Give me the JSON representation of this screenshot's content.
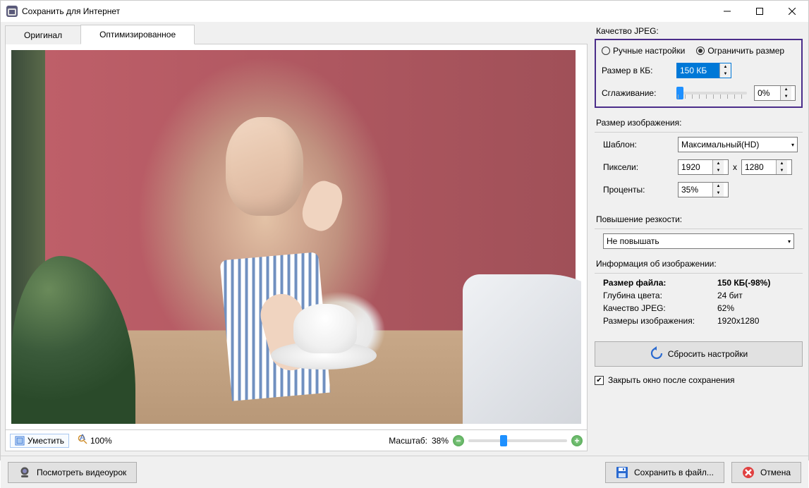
{
  "window": {
    "title": "Сохранить для Интернет"
  },
  "tabs": {
    "original": "Оригинал",
    "optimized": "Оптимизированное"
  },
  "preview_bar": {
    "fit_label": "Уместить",
    "zoom_auto_label": "100%",
    "scale_label": "Масштаб:",
    "scale_value": "38%"
  },
  "quality": {
    "group_label": "Качество JPEG:",
    "manual_label": "Ручные настройки",
    "limit_label": "Ограничить размер",
    "size_kb_label": "Размер в КБ:",
    "size_kb_value": "150 КБ",
    "smoothing_label": "Сглаживание:",
    "smoothing_value": "0%"
  },
  "image_size": {
    "group_label": "Размер изображения:",
    "template_label": "Шаблон:",
    "template_value": "Максимальный(HD)",
    "pixels_label": "Пиксели:",
    "pixels_w": "1920",
    "pixels_x": "x",
    "pixels_h": "1280",
    "percent_label": "Проценты:",
    "percent_value": "35%"
  },
  "sharpen": {
    "group_label": "Повышение резкости:",
    "value": "Не повышать"
  },
  "info": {
    "group_label": "Информация об изображении:",
    "filesize_label": "Размер файла:",
    "filesize_value": "150 КБ(-98%)",
    "depth_label": "Глубина цвета:",
    "depth_value": "24 бит",
    "jpeg_label": "Качество JPEG:",
    "jpeg_value": "62%",
    "dims_label": "Размеры изображения:",
    "dims_value": "1920x1280"
  },
  "reset_label": "Сбросить настройки",
  "close_after_save_label": "Закрыть окно после сохранения",
  "bottom": {
    "tutorial_label": "Посмотреть видеоурок",
    "save_label": "Сохранить в файл...",
    "cancel_label": "Отмена"
  }
}
